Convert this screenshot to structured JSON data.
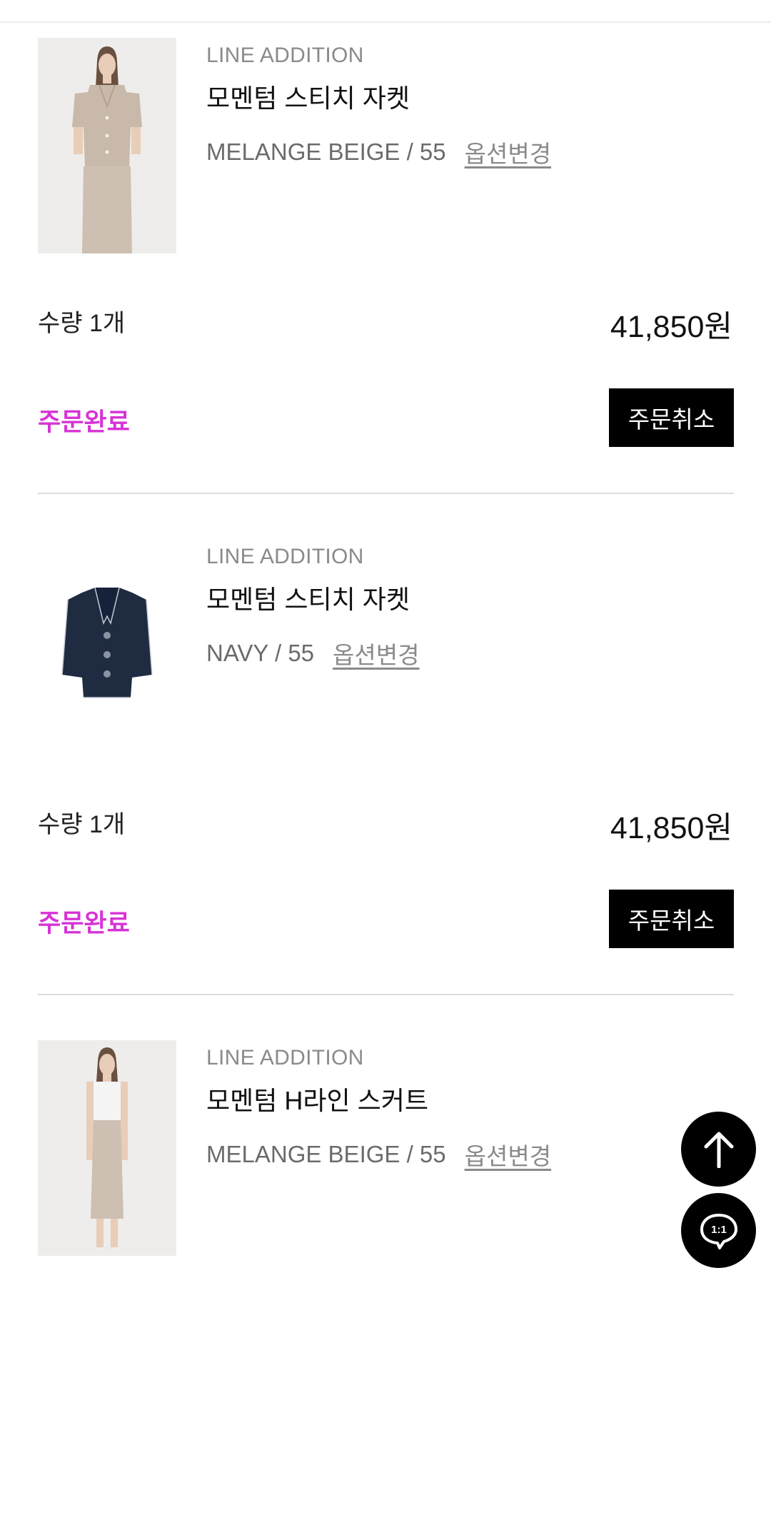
{
  "items": [
    {
      "brand": "LINE ADDITION",
      "name": "모멘텀 스티치 자켓",
      "option": "MELANGE BEIGE / 55",
      "option_change": "옵션변경",
      "quantity": "수량 1개",
      "price": "41,850원",
      "status": "주문완료",
      "cancel_label": "주문취소",
      "image": "model-beige-jacket-photo"
    },
    {
      "brand": "LINE ADDITION",
      "name": "모멘텀 스티치 자켓",
      "option": "NAVY / 55",
      "option_change": "옵션변경",
      "quantity": "수량 1개",
      "price": "41,850원",
      "status": "주문완료",
      "cancel_label": "주문취소",
      "image": "navy-jacket-flat-photo"
    },
    {
      "brand": "LINE ADDITION",
      "name": "모멘텀 H라인 스커트",
      "option": "MELANGE BEIGE / 55",
      "option_change": "옵션변경",
      "image": "model-beige-skirt-photo"
    }
  ],
  "floating": {
    "scroll_top_icon": "arrow-up-icon",
    "chat_icon": "chat-1on1-icon",
    "chat_label": "1:1"
  },
  "colors": {
    "status": "#d633d6",
    "button_bg": "#000000",
    "divider": "#dcdcdc"
  }
}
